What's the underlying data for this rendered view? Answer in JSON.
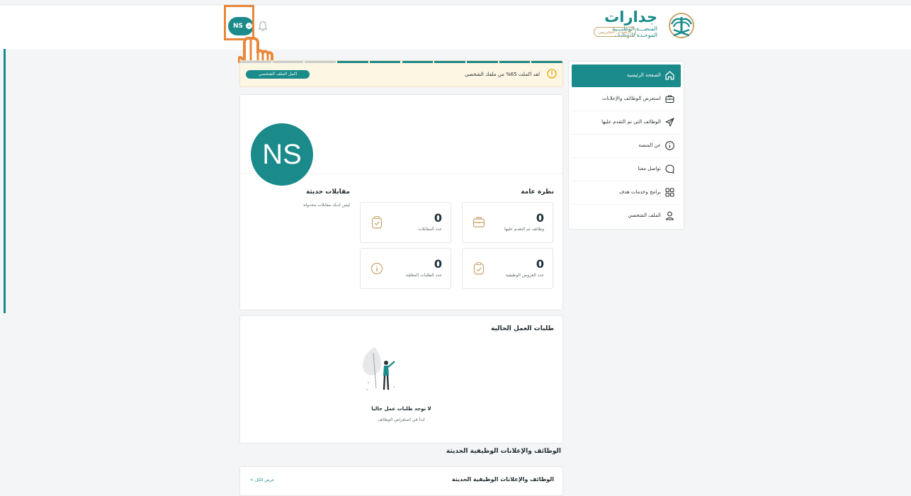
{
  "brand": {
    "name": "جدارات",
    "subtitle_line1": "المنصـــة الوطنـــية",
    "subtitle_line2": "الموحـدة للتوظيف",
    "badge": "الإصدار التجريبي"
  },
  "user": {
    "initials": "NS"
  },
  "colors": {
    "primary": "#1a8a8a",
    "warning": "#e0a800",
    "accent_gold": "#c8a46a",
    "highlight": "#e8873a"
  },
  "sidebar": {
    "items": [
      {
        "label": "الصفحة الرئيسية",
        "icon": "home-icon",
        "active": true
      },
      {
        "label": "استعرض الوظائف والإعلانات",
        "icon": "briefcase-icon",
        "active": false
      },
      {
        "label": "الوظائف التي تم التقدم عليها",
        "icon": "send-icon",
        "active": false
      },
      {
        "label": "عن المنصة",
        "icon": "info-icon",
        "active": false
      },
      {
        "label": "تواصل معنا",
        "icon": "chat-icon",
        "active": false
      },
      {
        "label": "برامج وخدمات هدف",
        "icon": "grid-icon",
        "active": false
      },
      {
        "label": "الملف الشخصي",
        "icon": "user-icon",
        "active": false
      }
    ]
  },
  "profile_progress": {
    "message": "لقد اكملت 65% من ملفك الشخصي",
    "percent": 65,
    "cta": "اكمل الملف الشخصي"
  },
  "overview": {
    "title": "نظرة عامة",
    "stats": [
      {
        "value": "0",
        "label": "وظائف تم التقدم عليها",
        "icon": "briefcase-icon"
      },
      {
        "value": "0",
        "label": "عدد المقابلات",
        "icon": "clipboard-check-icon"
      },
      {
        "value": "0",
        "label": "عدد العروض الوظيفية",
        "icon": "clipboard-check-icon"
      },
      {
        "value": "0",
        "label": "عدد الطلبات المغلقة",
        "icon": "info-icon"
      }
    ]
  },
  "interviews": {
    "title": "مقابلات حديثة",
    "empty": "ليس لديك مقابلات مجدولة"
  },
  "applications": {
    "title": "طلبات العمل الحالية",
    "empty_title": "لا توجد طلبات عمل حاليا",
    "empty_sub": "ابدأ في استعراض الوظائف"
  },
  "jobs": {
    "heading": "الوظائف والإعلانات الوظيفية الحديثة",
    "card_title": "الوظائف والإعلانات الوظيفية الحديثة",
    "view_all": "عرض الكل >"
  }
}
